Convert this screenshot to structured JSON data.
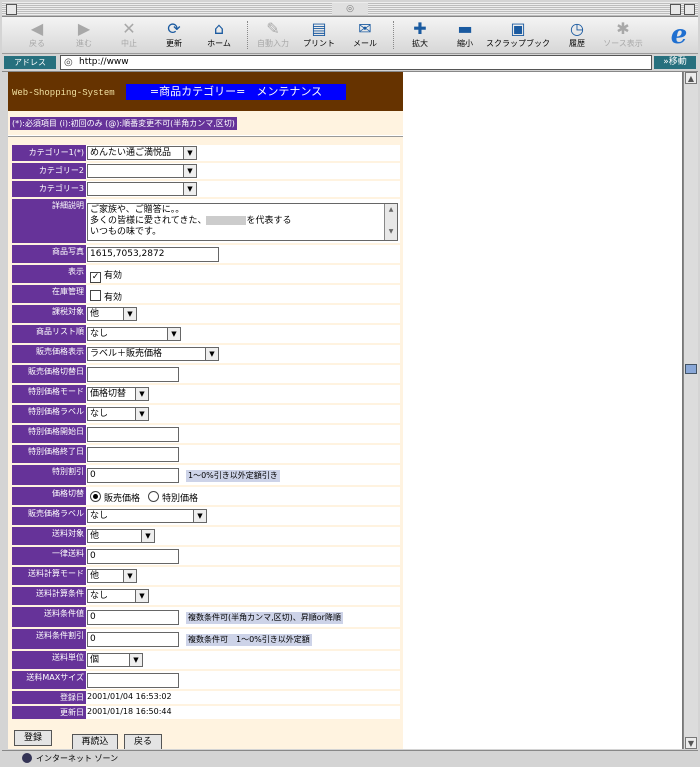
{
  "browser": {
    "toolbar": [
      {
        "label": "戻る",
        "icon": "back-arrow-icon",
        "enabled": false
      },
      {
        "label": "進む",
        "icon": "forward-arrow-icon",
        "enabled": false
      },
      {
        "label": "中止",
        "icon": "stop-x-icon",
        "enabled": false
      },
      {
        "label": "更新",
        "icon": "refresh-icon",
        "enabled": true
      },
      {
        "label": "ホーム",
        "icon": "home-icon",
        "enabled": true
      },
      {
        "label": "自動入力",
        "icon": "autofill-pen-icon",
        "enabled": false
      },
      {
        "label": "プリント",
        "icon": "printer-icon",
        "enabled": true
      },
      {
        "label": "メール",
        "icon": "mail-icon",
        "enabled": true
      },
      {
        "label": "拡大",
        "icon": "zoom-in-icon",
        "enabled": true
      },
      {
        "label": "縮小",
        "icon": "zoom-out-icon",
        "enabled": true
      },
      {
        "label": "スクラップブック",
        "icon": "camera-icon",
        "enabled": true
      },
      {
        "label": "履歴",
        "icon": "clock-icon",
        "enabled": true
      },
      {
        "label": "ソース表示",
        "icon": "source-view-icon",
        "enabled": false
      }
    ],
    "address_label": "アドレス",
    "address_value": "http://www",
    "go_label": "移動",
    "status_text": "インターネット ゾーン"
  },
  "page": {
    "site_name": "Web-Shopping-System",
    "title": "=商品カテゴリー=　メンテナンス",
    "legend": "(*):必須項目 (i):初回のみ (@):順番変更不可(半角カンマ,区切)"
  },
  "form": {
    "category1": {
      "label": "カテゴリー1(*)",
      "value": "めんたい通ご満悦品"
    },
    "category2": {
      "label": "カテゴリー2",
      "value": ""
    },
    "category3": {
      "label": "カテゴリー3",
      "value": ""
    },
    "description": {
      "label": "詳細説明",
      "line1": "ご家族や、ご贈答に。。",
      "line2a": "多くの皆様に愛されてきた、",
      "line2b": "を代表する",
      "line3": "いつもの味です。"
    },
    "photo": {
      "label": "商品写真",
      "value": "1615,7053,2872"
    },
    "display": {
      "label": "表示",
      "option": "有効",
      "checked": true
    },
    "stock": {
      "label": "在庫管理",
      "option": "有効",
      "checked": false
    },
    "tax": {
      "label": "課税対象",
      "value": "他"
    },
    "list_order": {
      "label": "商品リスト順",
      "value": "なし"
    },
    "price_display": {
      "label": "販売価格表示",
      "value": "ラベル＋販売価格"
    },
    "price_switch_date": {
      "label": "販売価格切替日",
      "value": ""
    },
    "special_mode": {
      "label": "特別価格モード",
      "value": "価格切替"
    },
    "special_label": {
      "label": "特別価格ラベル",
      "value": "なし"
    },
    "special_start": {
      "label": "特別価格開始日",
      "value": ""
    },
    "special_end": {
      "label": "特別価格終了日",
      "value": ""
    },
    "special_discount": {
      "label": "特別割引",
      "value": "0",
      "note": "1〜0%引き以外定額引き"
    },
    "price_switch": {
      "label": "価格切替",
      "option1": "販売価格",
      "option2": "特別価格",
      "selected": "販売価格"
    },
    "price_label": {
      "label": "販売価格ラベル",
      "value": "なし"
    },
    "shipping_target": {
      "label": "送料対象",
      "value": "他"
    },
    "flat_rate": {
      "label": "一律送料",
      "value": "0"
    },
    "shipping_mode": {
      "label": "送料計算モード",
      "value": "他"
    },
    "shipping_condition": {
      "label": "送料計算条件",
      "value": "なし"
    },
    "shipping_cond_value": {
      "label": "送料条件値",
      "value": "0",
      "note": "複数条件可(半角カンマ,区切)、昇順or降順"
    },
    "shipping_cond_discount": {
      "label": "送料条件割引",
      "value": "0",
      "note": "複数条件可　1〜0%引き以外定額"
    },
    "shipping_unit": {
      "label": "送料単位",
      "value": "個"
    },
    "shipping_max": {
      "label": "送料MAXサイズ",
      "value": ""
    },
    "registered": {
      "label": "登録日",
      "value": "2001/01/04 16:53:02"
    },
    "updated": {
      "label": "更新日",
      "value": "2001/01/18 16:50:44"
    }
  },
  "buttons": {
    "register": "登録",
    "reload": "再読込",
    "back": "戻る"
  }
}
